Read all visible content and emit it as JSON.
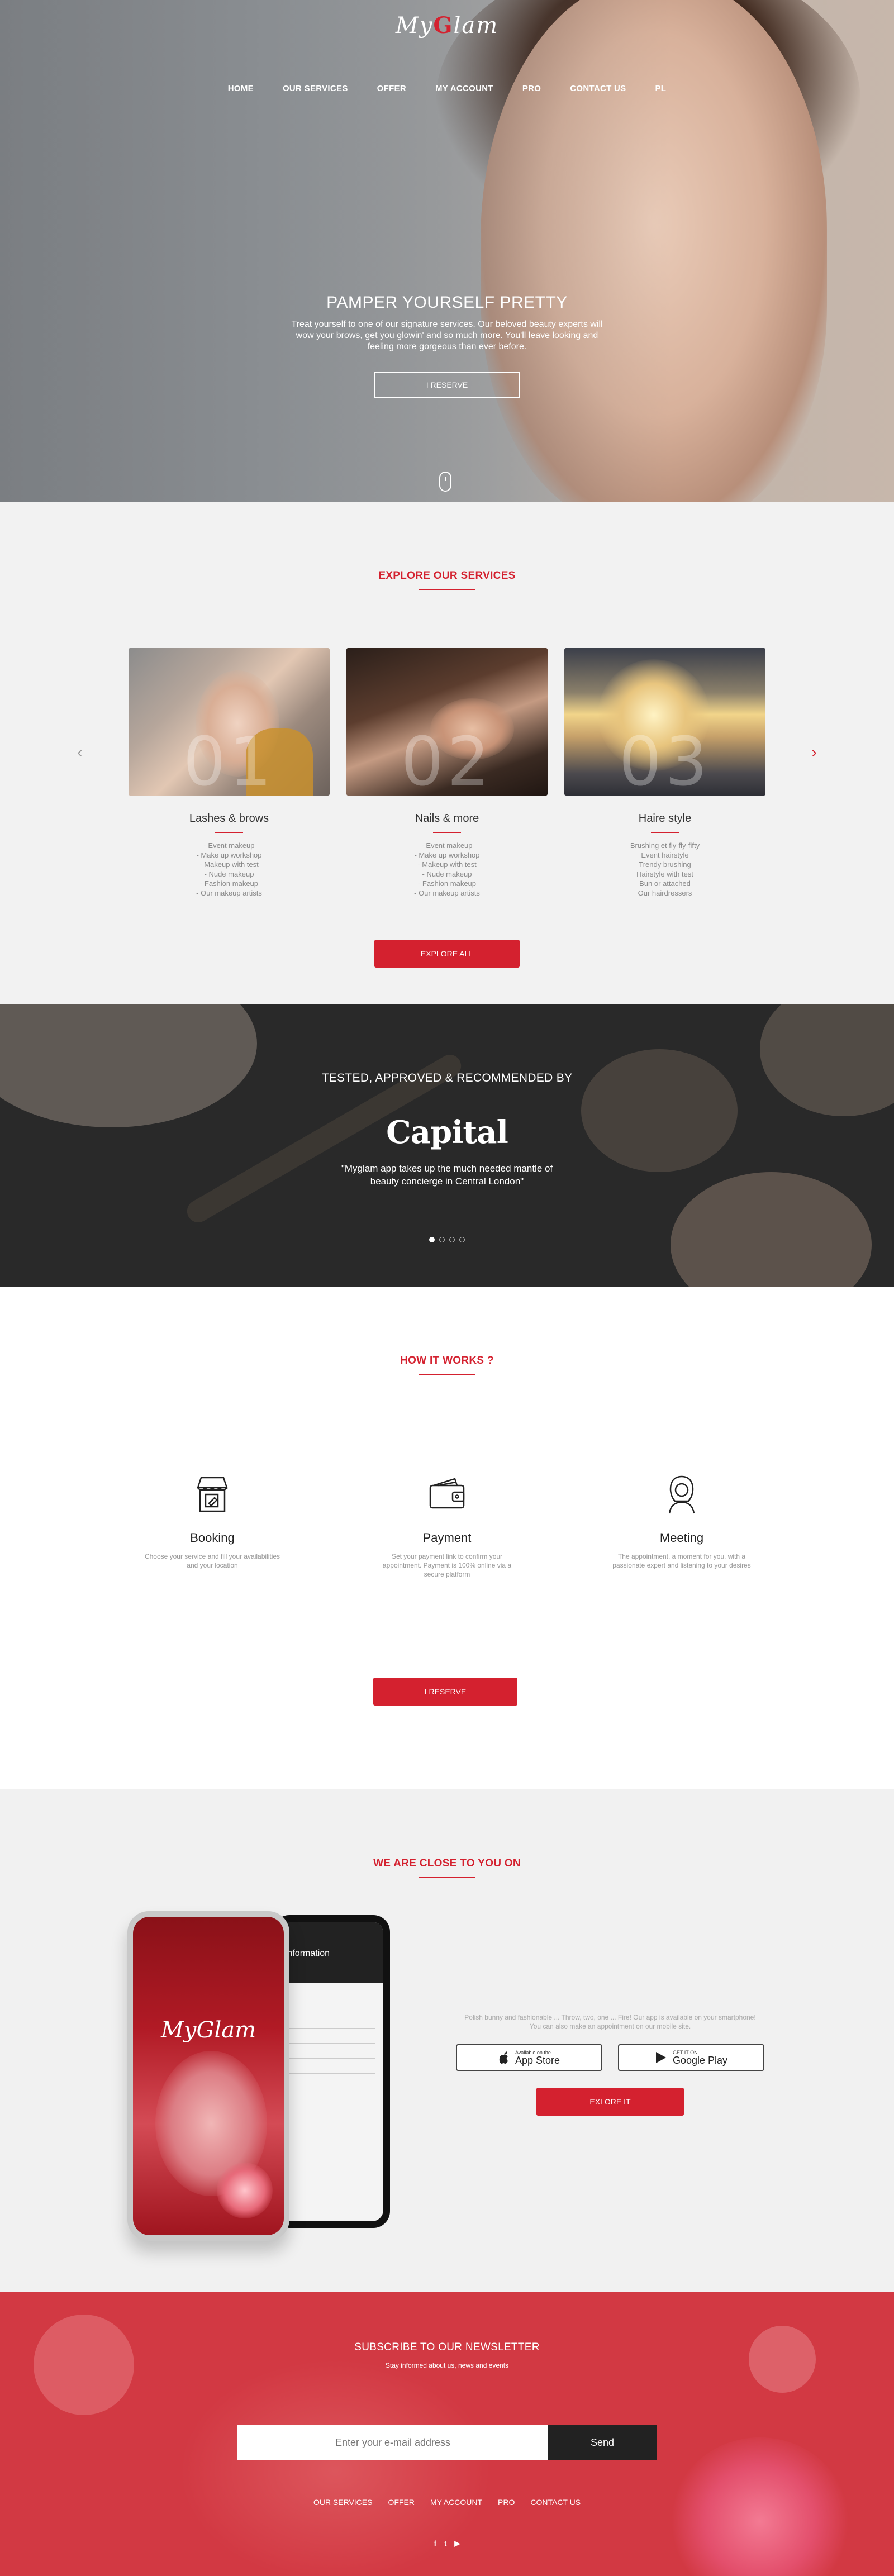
{
  "brand": {
    "logo_pre": "My",
    "logo_mark": "G",
    "logo_post": "lam"
  },
  "nav": [
    "HOME",
    "OUR SERVICES",
    "OFFER",
    "MY ACCOUNT",
    "PRO",
    "CONTACT US",
    "PL"
  ],
  "hero": {
    "title": "PAMPER YOURSELF PRETTY",
    "text": "Treat yourself to one of our signature services. Our beloved beauty experts will wow your brows, get you glowin' and so much more. You'll leave looking and feeling more gorgeous than ever before.",
    "button": "I RESERVE"
  },
  "services": {
    "title": "EXPLORE OUR SERVICES",
    "prev": "‹",
    "next": "›",
    "cards": [
      {
        "num": "01",
        "title": "Lashes & brows",
        "items": [
          "- Event makeup",
          "- Make up workshop",
          "- Makeup with test",
          "- Nude makeup",
          "- Fashion makeup",
          "- Our makeup artists"
        ]
      },
      {
        "num": "02",
        "title": "Nails & more",
        "items": [
          "- Event makeup",
          "- Make up workshop",
          "- Makeup with test",
          "- Nude makeup",
          "- Fashion makeup",
          "- Our makeup artists"
        ]
      },
      {
        "num": "03",
        "title": "Haire style",
        "items": [
          "Brushing et fly-fly-fifty",
          "Event hairstyle",
          "Trendy brushing",
          "Hairstyle with test",
          "Bun or attached",
          "Our hairdressers"
        ]
      }
    ],
    "button": "EXPLORE ALL"
  },
  "press": {
    "title": "TESTED, APPROVED & RECOMMENDED BY",
    "brand": "Capital",
    "quote": "\"Myglam app takes up the much needed mantle of beauty concierge in Central London\"",
    "slides": 4,
    "active_slide": 1
  },
  "how": {
    "title": "HOW IT WORKS ?",
    "steps": [
      {
        "icon": "shop-icon",
        "title": "Booking",
        "text": "Choose your service and fill your availabilities and your location"
      },
      {
        "icon": "wallet-icon",
        "title": "Payment",
        "text": "Set your payment link to confirm your appointment. Payment is 100% online via a secure platform"
      },
      {
        "icon": "beautician-icon",
        "title": "Meeting",
        "text": "The appointment, a moment for you, with a passionate expert and listening to your desires"
      }
    ],
    "button": "I RESERVE"
  },
  "app": {
    "title": "WE ARE CLOSE TO YOU ON",
    "text": "Polish bunny and fashionable ... Throw, two, one ... Fire! Our app is available on your smartphone! You can also make an appointment on our mobile site.",
    "appstore_small": "Available on the",
    "appstore_big": "App Store",
    "google_small": "GET IT ON",
    "google_big": "Google Play",
    "button": "EXLORE IT",
    "phone_back_title": "Information",
    "phone_front_logo": "MyGlam"
  },
  "newsletter": {
    "title": "SUBSCRIBE TO OUR NEWSLETTER",
    "subtitle": "Stay informed about us, news and events",
    "placeholder": "Enter your e-mail address",
    "button": "Send",
    "footer_nav": [
      "OUR SERVICES",
      "OFFER",
      "MY ACCOUNT",
      "PRO",
      "CONTACT US"
    ],
    "social": [
      {
        "icon": "facebook-icon",
        "glyph": "f"
      },
      {
        "icon": "twitter-icon",
        "glyph": "t"
      },
      {
        "icon": "youtube-icon",
        "glyph": "▶"
      }
    ]
  },
  "colors": {
    "accent": "#d4212f",
    "dark": "#222222",
    "light_bg": "#f2f2f2"
  }
}
